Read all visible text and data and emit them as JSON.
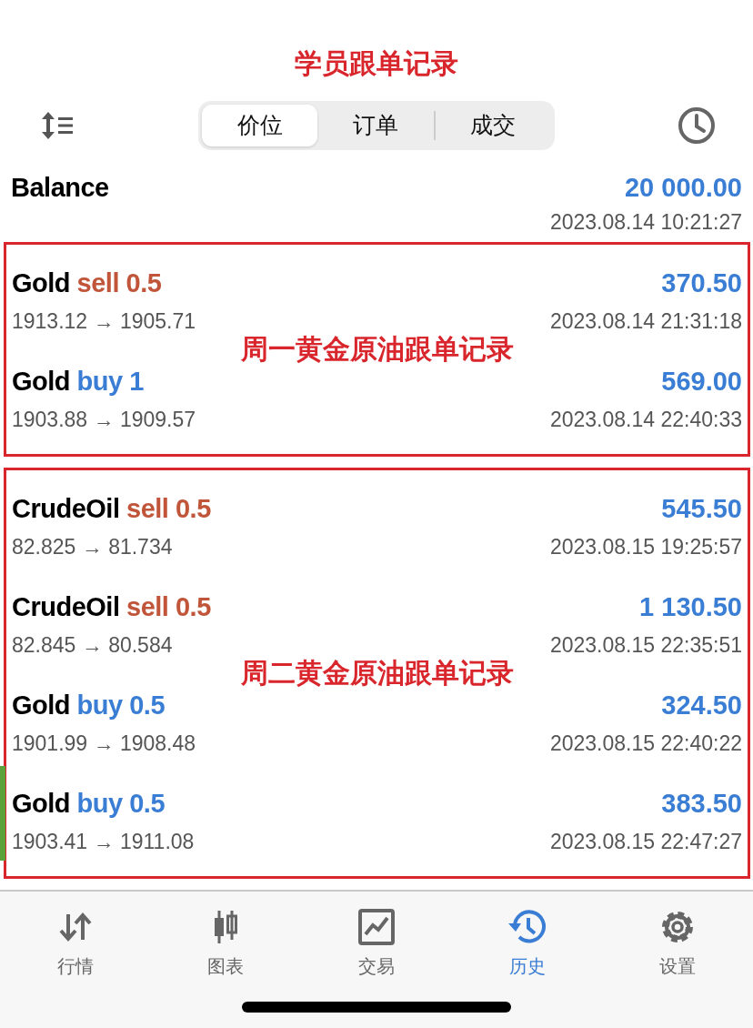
{
  "title": "学员跟单记录",
  "tabs": [
    {
      "label": "价位",
      "selected": true
    },
    {
      "label": "订单",
      "selected": false
    },
    {
      "label": "成交",
      "selected": false
    }
  ],
  "balance": {
    "label": "Balance",
    "value": "20 000.00",
    "time": "2023.08.14 10:21:27"
  },
  "groups": [
    {
      "note": "周一黄金原油跟单记录",
      "trades": [
        {
          "symbol": "Gold",
          "kind": "sell",
          "order": "sell 0.5",
          "profit": "370.50",
          "prices": "1913.12 → 1905.71",
          "time": "2023.08.14 21:31:18"
        },
        {
          "symbol": "Gold",
          "kind": "buy",
          "order": "buy 1",
          "profit": "569.00",
          "prices": "1903.88 → 1909.57",
          "time": "2023.08.14 22:40:33"
        }
      ]
    },
    {
      "note": "周二黄金原油跟单记录",
      "trades": [
        {
          "symbol": "CrudeOil",
          "kind": "sell",
          "order": "sell 0.5",
          "profit": "545.50",
          "prices": "82.825 → 81.734",
          "time": "2023.08.15 19:25:57"
        },
        {
          "symbol": "CrudeOil",
          "kind": "sell",
          "order": "sell 0.5",
          "profit": "1 130.50",
          "prices": "82.845 → 80.584",
          "time": "2023.08.15 22:35:51"
        },
        {
          "symbol": "Gold",
          "kind": "buy",
          "order": "buy 0.5",
          "profit": "324.50",
          "prices": "1901.99 → 1908.48",
          "time": "2023.08.15 22:40:22"
        },
        {
          "symbol": "Gold",
          "kind": "buy",
          "order": "buy 0.5",
          "profit": "383.50",
          "prices": "1903.41 → 1911.08",
          "time": "2023.08.15 22:47:27"
        }
      ]
    }
  ],
  "nav": [
    {
      "label": "行情",
      "selected": false
    },
    {
      "label": "图表",
      "selected": false
    },
    {
      "label": "交易",
      "selected": false
    },
    {
      "label": "历史",
      "selected": true
    },
    {
      "label": "设置",
      "selected": false
    }
  ]
}
